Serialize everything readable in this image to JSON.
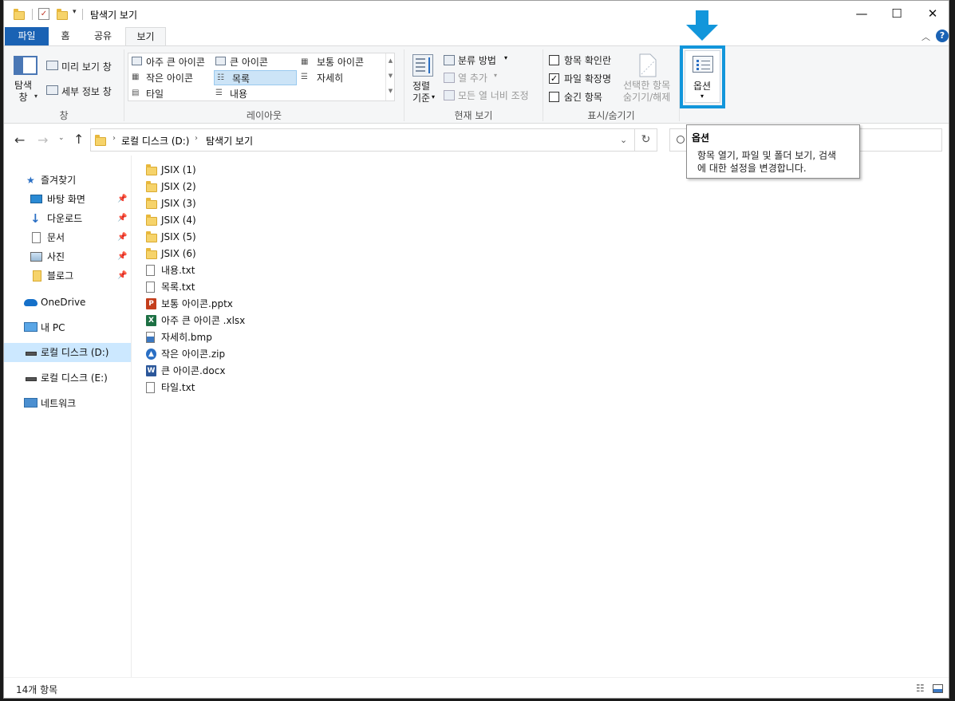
{
  "window": {
    "title": "탐색기 보기",
    "controls": {
      "minimize": "—",
      "maximize": "☐",
      "close": "✕"
    }
  },
  "ribbon_tabs": [
    {
      "label": "파일"
    },
    {
      "label": "홈"
    },
    {
      "label": "공유"
    },
    {
      "label": "보기"
    }
  ],
  "ribbon": {
    "pane_group": {
      "nav_pane": "탐색\n창",
      "preview": "미리 보기 창",
      "details": "세부 정보 창",
      "label": "창"
    },
    "layout_group": {
      "items": [
        "아주 큰 아이콘",
        "큰 아이콘",
        "보통 아이콘",
        "작은 아이콘",
        "목록",
        "자세히",
        "타일",
        "내용"
      ],
      "selected": "목록",
      "label": "레이아웃"
    },
    "current_view_group": {
      "sort": "정렬\n기준",
      "group_by": "분류 방법",
      "add_column": "열 추가",
      "fit_columns": "모든 열 너비 조정",
      "label": "현재 보기"
    },
    "show_hide_group": {
      "item_checkboxes": "항목 확인란",
      "file_extensions": "파일 확장명",
      "hidden_items": "숨긴 항목",
      "hide_selected": "선택한 항목\n숨기기/해제",
      "checked": {
        "item_checkboxes": false,
        "file_extensions": true,
        "hidden_items": false
      },
      "label": "표시/숨기기"
    },
    "options": {
      "label": "옵션"
    }
  },
  "address": {
    "path": [
      "로컬 디스크 (D:)",
      "탐색기 보기"
    ]
  },
  "sidebar": {
    "quick_access": "즐겨찾기",
    "pinned": [
      {
        "label": "바탕 화면",
        "icon": "desktop-icon"
      },
      {
        "label": "다운로드",
        "icon": "download-icon"
      },
      {
        "label": "문서",
        "icon": "documents-icon"
      },
      {
        "label": "사진",
        "icon": "pictures-icon"
      },
      {
        "label": "블로그",
        "icon": "folder-icon"
      }
    ],
    "onedrive": "OneDrive",
    "this_pc": "내 PC",
    "drive_d": "로컬 디스크 (D:)",
    "drive_e": "로컬 디스크 (E:)",
    "network": "네트워크"
  },
  "files": [
    {
      "name": "JSIX (1)",
      "type": "folder"
    },
    {
      "name": "JSIX (2)",
      "type": "folder"
    },
    {
      "name": "JSIX (3)",
      "type": "folder"
    },
    {
      "name": "JSIX (4)",
      "type": "folder"
    },
    {
      "name": "JSIX (5)",
      "type": "folder"
    },
    {
      "name": "JSIX (6)",
      "type": "folder"
    },
    {
      "name": "내용.txt",
      "type": "txt"
    },
    {
      "name": "목록.txt",
      "type": "txt"
    },
    {
      "name": "보통 아이콘.pptx",
      "type": "pptx"
    },
    {
      "name": "아주 큰 아이콘 .xlsx",
      "type": "xlsx"
    },
    {
      "name": "자세히.bmp",
      "type": "bmp"
    },
    {
      "name": "작은 아이콘.zip",
      "type": "zip"
    },
    {
      "name": "큰 아이콘.docx",
      "type": "docx"
    },
    {
      "name": "타일.txt",
      "type": "txt"
    }
  ],
  "tooltip": {
    "title": "옵션",
    "body": "항목 열기, 파일 및 폴더 보기, 검색\n에 대한 설정을 변경합니다."
  },
  "status": {
    "count": "14개 항목"
  },
  "colors": {
    "highlight": "#1296db",
    "file_tab": "#1a62b4",
    "selection": "#cce8ff"
  }
}
